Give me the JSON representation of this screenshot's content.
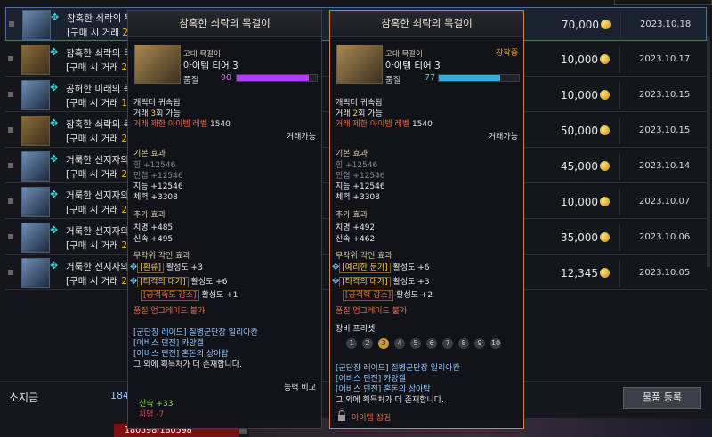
{
  "list": {
    "rows": [
      {
        "name": "참혹한 쇠락의 목",
        "sub_prefix": "[구매 시 거래 ",
        "sub_hl": "2호",
        "price": "70,000",
        "date": "2023.10.18",
        "icon": "blue"
      },
      {
        "name": "참혹한 쇠락의 목",
        "sub_prefix": "[구매 시 거래 ",
        "sub_hl": "2호",
        "price": "10,000",
        "date": "2023.10.17",
        "icon": "gold"
      },
      {
        "name": "공허한 미래의 목",
        "sub_prefix": "[구매 시 거래 ",
        "sub_hl": "1호",
        "price": "10,000",
        "date": "2023.10.15",
        "icon": "blue"
      },
      {
        "name": "참혹한 쇠락의 목",
        "sub_prefix": "[구매 시 거래 ",
        "sub_hl": "2호",
        "price": "50,000",
        "date": "2023.10.15",
        "icon": "gold"
      },
      {
        "name": "거룩한 선지자의",
        "sub_prefix": "[구매 시 거래 ",
        "sub_hl": "2호",
        "price": "45,000",
        "date": "2023.10.14",
        "icon": "blue"
      },
      {
        "name": "거룩한 선지자의",
        "sub_prefix": "[구매 시 거래 ",
        "sub_hl": "2호",
        "price": "10,000",
        "date": "2023.10.07",
        "icon": "blue"
      },
      {
        "name": "거룩한 선지자의",
        "sub_prefix": "[구매 시 거래 ",
        "sub_hl": "2호",
        "price": "35,000",
        "date": "2023.10.06",
        "icon": "blue"
      },
      {
        "name": "거룩한 선지자의",
        "sub_prefix": "[구매 시 거래 ",
        "sub_hl": "2호",
        "price": "12,345",
        "date": "2023.10.05",
        "icon": "blue"
      }
    ]
  },
  "bottom": {
    "gold_label": "소지금",
    "gold_value": "184",
    "register_label": "물품 등록",
    "hp": "180598/180598"
  },
  "tipA": {
    "title": "참혹한 쇠락의 목걸이",
    "type": "고대 목걸이",
    "tier": "아이템 티어 3",
    "quality_label": "품질",
    "quality": "90",
    "quality_pct": 0.9,
    "quality_color": "#b23cf0",
    "bound": "캐릭터 귀속됨",
    "trade_pre": "거래 ",
    "trade_n": "3",
    "trade_post": "회 가능",
    "trade_level_label": "거래 제한 아이템 레벨",
    "trade_level": "1540",
    "tradeable": "거래가능",
    "base_title": "기본 효과",
    "base": [
      "힘 +12546",
      "민첩 +12546",
      "지능 +12546",
      "체력 +3308"
    ],
    "add_title": "추가 효과",
    "add": [
      "치명 +485",
      "신속 +495"
    ],
    "engr_title": "무작위 각인 효과",
    "engr": [
      {
        "name": "[환류]",
        "val": " 활성도 +3"
      },
      {
        "name": "[타격의 대가]",
        "val": " 활성도 +6"
      },
      {
        "name": "[공격속도 감소]",
        "val": " 활성도 +1"
      }
    ],
    "no_upgrade": "품질 업그레이드 불가",
    "sources": [
      "[군단장 레이드] 질병군단장 일리아칸",
      "[어비스 던전] 카양겔",
      "[어비스 던전] 혼돈의 상아탑",
      "그 외에 획득처가 더 존재합니다."
    ],
    "compare_label": "능력 비교",
    "compare": [
      "신속 +33",
      "치명 -7"
    ]
  },
  "tipB": {
    "title": "참혹한 쇠락의 목걸이",
    "equipped": "장착중",
    "type": "고대 목걸이",
    "tier": "아이템 티어 3",
    "quality_label": "품질",
    "quality": "77",
    "quality_pct": 0.77,
    "quality_color": "#3aa8e0",
    "bound": "캐릭터 귀속됨",
    "trade_pre": "거래 ",
    "trade_n": "2",
    "trade_post": "회 가능",
    "trade_level_label": "거래 제한 아이템 레벨",
    "trade_level": "1540",
    "tradeable": "거래가능",
    "base_title": "기본 효과",
    "base": [
      "힘 +12546",
      "민첩 +12546",
      "지능 +12546",
      "체력 +3308"
    ],
    "add_title": "추가 효과",
    "add": [
      "치명 +492",
      "신속 +462"
    ],
    "engr_title": "무작위 각인 효과",
    "engr": [
      {
        "name": "[예리한 둔기]",
        "val": " 활성도 +6"
      },
      {
        "name": "[타격의 대가]",
        "val": " 활성도 +3"
      },
      {
        "name": "[공격력 감소]",
        "val": " 활성도 +2"
      }
    ],
    "no_upgrade": "품질 업그레이드 불가",
    "preset_title": "장비 프리셋",
    "presets": [
      "1",
      "2",
      "3",
      "4",
      "5",
      "6",
      "7",
      "8",
      "9",
      "10"
    ],
    "preset_active": "3",
    "sources": [
      "[군단장 레이드] 질병군단장 일리아칸",
      "[어비스 던전] 카양겔",
      "[어비스 던전] 혼돈의 상아탑",
      "그 외에 획득처가 더 존재합니다."
    ],
    "lock_label": "아이템 잠김"
  }
}
